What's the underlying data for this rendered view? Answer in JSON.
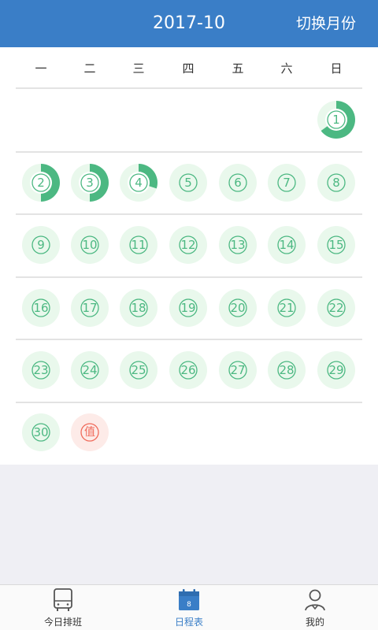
{
  "header": {
    "title": "2017-10",
    "switch_label": "切换月份"
  },
  "weekdays": [
    "一",
    "二",
    "三",
    "四",
    "五",
    "六",
    "日"
  ],
  "days": [
    {
      "label": "1",
      "progress": 0.65
    },
    {
      "label": "2",
      "progress": 0.5
    },
    {
      "label": "3",
      "progress": 0.5
    },
    {
      "label": "4",
      "progress": 0.3
    },
    {
      "label": "5",
      "progress": 0
    },
    {
      "label": "6",
      "progress": 0
    },
    {
      "label": "7",
      "progress": 0
    },
    {
      "label": "8",
      "progress": 0
    },
    {
      "label": "9",
      "progress": 0
    },
    {
      "label": "10",
      "progress": 0
    },
    {
      "label": "11",
      "progress": 0
    },
    {
      "label": "12",
      "progress": 0
    },
    {
      "label": "13",
      "progress": 0
    },
    {
      "label": "14",
      "progress": 0
    },
    {
      "label": "15",
      "progress": 0
    },
    {
      "label": "16",
      "progress": 0
    },
    {
      "label": "17",
      "progress": 0
    },
    {
      "label": "18",
      "progress": 0
    },
    {
      "label": "19",
      "progress": 0
    },
    {
      "label": "20",
      "progress": 0
    },
    {
      "label": "21",
      "progress": 0
    },
    {
      "label": "22",
      "progress": 0
    },
    {
      "label": "23",
      "progress": 0
    },
    {
      "label": "24",
      "progress": 0
    },
    {
      "label": "25",
      "progress": 0
    },
    {
      "label": "26",
      "progress": 0
    },
    {
      "label": "27",
      "progress": 0
    },
    {
      "label": "28",
      "progress": 0
    },
    {
      "label": "29",
      "progress": 0
    },
    {
      "label": "30",
      "progress": 0
    },
    {
      "label": "值",
      "progress": 0,
      "type": "duty"
    }
  ],
  "colors": {
    "header_bg": "#3a7ec7",
    "ring": "#4cb882",
    "day_fill": "#e9f8ec",
    "duty_fill": "#fdebe8",
    "duty_ring": "#f06a5a"
  },
  "tabbar": {
    "items": [
      {
        "label": "今日排班",
        "icon": "bus-icon",
        "active": false
      },
      {
        "label": "日程表",
        "icon": "calendar-icon",
        "active": true
      },
      {
        "label": "我的",
        "icon": "user-icon",
        "active": false
      }
    ]
  }
}
